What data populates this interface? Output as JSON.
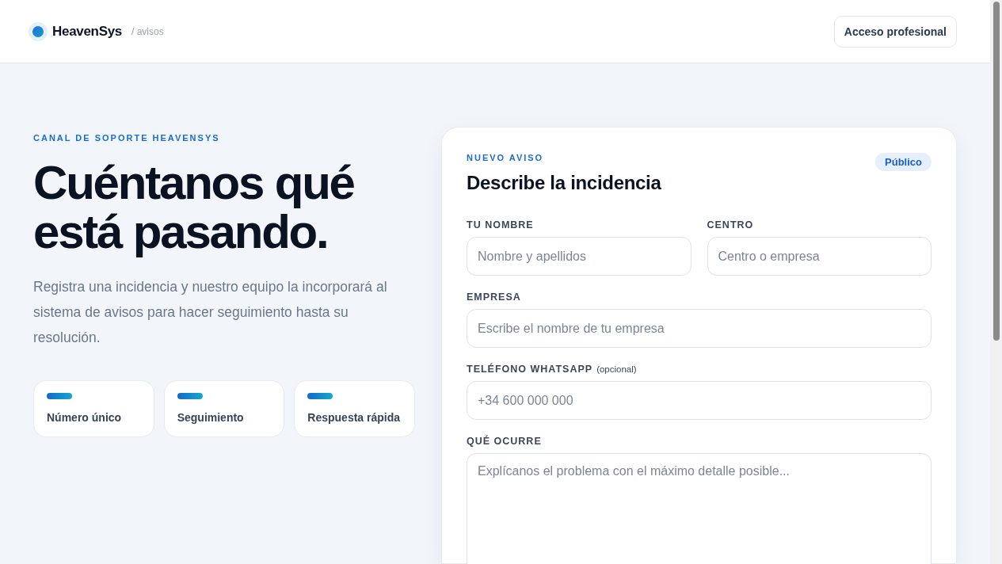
{
  "header": {
    "brand": "HeavenSys",
    "section": "/ avisos",
    "button": "Acceso profesional"
  },
  "intro": {
    "eyebrow": "CANAL DE SOPORTE HEAVENSYS",
    "title": "Cuéntanos qué está pasando.",
    "text": "Registra una incidencia y nuestro equipo la incorporará al sistema de avisos para hacer seguimiento hasta su resolución.",
    "features": [
      "Número único",
      "Seguimiento",
      "Respuesta rápida"
    ]
  },
  "form": {
    "eyebrow": "NUEVO AVISO",
    "title": "Describe la incidencia",
    "badge": "Público",
    "rows": [
      [
        {
          "kind": "input",
          "label": "TU NOMBRE",
          "placeholder": "Nombre y apellidos"
        },
        {
          "kind": "input",
          "label": "CENTRO",
          "placeholder": "Centro o empresa"
        }
      ],
      [
        {
          "kind": "input",
          "label": "EMPRESA",
          "placeholder": "Escribe el nombre de tu empresa"
        }
      ],
      [
        {
          "kind": "input",
          "label": "TELÉFONO WHATSAPP",
          "hint": "(opcional)",
          "placeholder": "+34 600 000 000"
        }
      ],
      [
        {
          "kind": "textarea",
          "label": "QUÉ OCURRE",
          "placeholder": "Explícanos el problema con el máximo detalle posible..."
        }
      ]
    ]
  }
}
